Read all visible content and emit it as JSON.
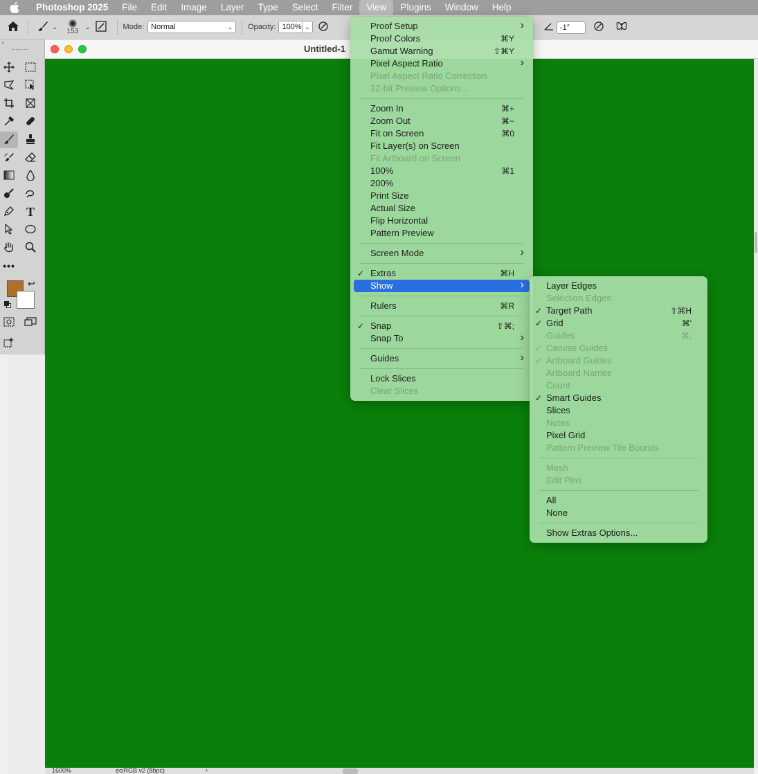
{
  "menubar": {
    "app": "Photoshop 2025",
    "items": [
      "File",
      "Edit",
      "Image",
      "Layer",
      "Type",
      "Select",
      "Filter",
      "View",
      "Plugins",
      "Window",
      "Help"
    ],
    "active": "View"
  },
  "options": {
    "brush_size": "153",
    "mode_label": "Mode:",
    "mode_value": "Normal",
    "opacity_label": "Opacity:",
    "opacity_value": "100%",
    "angle_value": "-1°"
  },
  "document": {
    "title": "Untitled-1",
    "canvas_color": "#0a7f0a",
    "zoom": "1600%",
    "profile": "eciRGB v2 (8bpc)"
  },
  "colors": {
    "foreground": "#b0702a",
    "background": "#ffffff",
    "menu_bg": "#a8dea8",
    "highlight": "#2a6fe0"
  },
  "view_menu": {
    "items": [
      {
        "label": "Proof Setup",
        "shortcut": "",
        "submenu": true,
        "disabled": false,
        "checked": false
      },
      {
        "label": "Proof Colors",
        "shortcut": "⌘Y",
        "submenu": false,
        "disabled": false,
        "checked": false
      },
      {
        "label": "Gamut Warning",
        "shortcut": "⇧⌘Y",
        "submenu": false,
        "disabled": false,
        "checked": false
      },
      {
        "label": "Pixel Aspect Ratio",
        "shortcut": "",
        "submenu": true,
        "disabled": false,
        "checked": false
      },
      {
        "label": "Pixel Aspect Ratio Correction",
        "shortcut": "",
        "submenu": false,
        "disabled": true,
        "checked": false
      },
      {
        "label": "32-bit Preview Options...",
        "shortcut": "",
        "submenu": false,
        "disabled": true,
        "checked": false
      },
      {
        "divider": true
      },
      {
        "label": "Zoom In",
        "shortcut": "⌘+",
        "submenu": false,
        "disabled": false,
        "checked": false
      },
      {
        "label": "Zoom Out",
        "shortcut": "⌘−",
        "submenu": false,
        "disabled": false,
        "checked": false
      },
      {
        "label": "Fit on Screen",
        "shortcut": "⌘0",
        "submenu": false,
        "disabled": false,
        "checked": false
      },
      {
        "label": "Fit Layer(s) on Screen",
        "shortcut": "",
        "submenu": false,
        "disabled": false,
        "checked": false
      },
      {
        "label": "Fit Artboard on Screen",
        "shortcut": "",
        "submenu": false,
        "disabled": true,
        "checked": false
      },
      {
        "label": "100%",
        "shortcut": "⌘1",
        "submenu": false,
        "disabled": false,
        "checked": false
      },
      {
        "label": "200%",
        "shortcut": "",
        "submenu": false,
        "disabled": false,
        "checked": false
      },
      {
        "label": "Print Size",
        "shortcut": "",
        "submenu": false,
        "disabled": false,
        "checked": false
      },
      {
        "label": "Actual Size",
        "shortcut": "",
        "submenu": false,
        "disabled": false,
        "checked": false
      },
      {
        "label": "Flip Horizontal",
        "shortcut": "",
        "submenu": false,
        "disabled": false,
        "checked": false
      },
      {
        "label": "Pattern Preview",
        "shortcut": "",
        "submenu": false,
        "disabled": false,
        "checked": false
      },
      {
        "divider": true
      },
      {
        "label": "Screen Mode",
        "shortcut": "",
        "submenu": true,
        "disabled": false,
        "checked": false
      },
      {
        "divider": true
      },
      {
        "label": "Extras",
        "shortcut": "⌘H",
        "submenu": false,
        "disabled": false,
        "checked": true
      },
      {
        "label": "Show",
        "shortcut": "",
        "submenu": true,
        "disabled": false,
        "checked": false,
        "highlighted": true
      },
      {
        "divider": true
      },
      {
        "label": "Rulers",
        "shortcut": "⌘R",
        "submenu": false,
        "disabled": false,
        "checked": false
      },
      {
        "divider": true
      },
      {
        "label": "Snap",
        "shortcut": "⇧⌘;",
        "submenu": false,
        "disabled": false,
        "checked": true
      },
      {
        "label": "Snap To",
        "shortcut": "",
        "submenu": true,
        "disabled": false,
        "checked": false
      },
      {
        "divider": true
      },
      {
        "label": "Guides",
        "shortcut": "",
        "submenu": true,
        "disabled": false,
        "checked": false
      },
      {
        "divider": true
      },
      {
        "label": "Lock Slices",
        "shortcut": "",
        "submenu": false,
        "disabled": false,
        "checked": false
      },
      {
        "label": "Clear Slices",
        "shortcut": "",
        "submenu": false,
        "disabled": true,
        "checked": false
      }
    ]
  },
  "show_menu": {
    "items": [
      {
        "label": "Layer Edges",
        "shortcut": "",
        "disabled": false,
        "checked": false
      },
      {
        "label": "Selection Edges",
        "shortcut": "",
        "disabled": true,
        "checked": false
      },
      {
        "label": "Target Path",
        "shortcut": "⇧⌘H",
        "disabled": false,
        "checked": true
      },
      {
        "label": "Grid",
        "shortcut": "⌘'",
        "disabled": false,
        "checked": true
      },
      {
        "label": "Guides",
        "shortcut": "⌘;",
        "disabled": true,
        "checked": false
      },
      {
        "label": "Canvas Guides",
        "shortcut": "",
        "disabled": true,
        "checked": true
      },
      {
        "label": "Artboard Guides",
        "shortcut": "",
        "disabled": true,
        "checked": true
      },
      {
        "label": "Artboard Names",
        "shortcut": "",
        "disabled": true,
        "checked": false
      },
      {
        "label": "Count",
        "shortcut": "",
        "disabled": true,
        "checked": false
      },
      {
        "label": "Smart Guides",
        "shortcut": "",
        "disabled": false,
        "checked": true
      },
      {
        "label": "Slices",
        "shortcut": "",
        "disabled": false,
        "checked": false
      },
      {
        "label": "Notes",
        "shortcut": "",
        "disabled": true,
        "checked": false
      },
      {
        "label": "Pixel Grid",
        "shortcut": "",
        "disabled": false,
        "checked": false
      },
      {
        "label": "Pattern Preview Tile Bounds",
        "shortcut": "",
        "disabled": true,
        "checked": false
      },
      {
        "divider": true
      },
      {
        "label": "Mesh",
        "shortcut": "",
        "disabled": true,
        "checked": false
      },
      {
        "label": "Edit Pins",
        "shortcut": "",
        "disabled": true,
        "checked": false
      },
      {
        "divider": true
      },
      {
        "label": "All",
        "shortcut": "",
        "disabled": false,
        "checked": false
      },
      {
        "label": "None",
        "shortcut": "",
        "disabled": false,
        "checked": false
      },
      {
        "divider": true
      },
      {
        "label": "Show Extras Options...",
        "shortcut": "",
        "disabled": false,
        "checked": false
      }
    ]
  }
}
